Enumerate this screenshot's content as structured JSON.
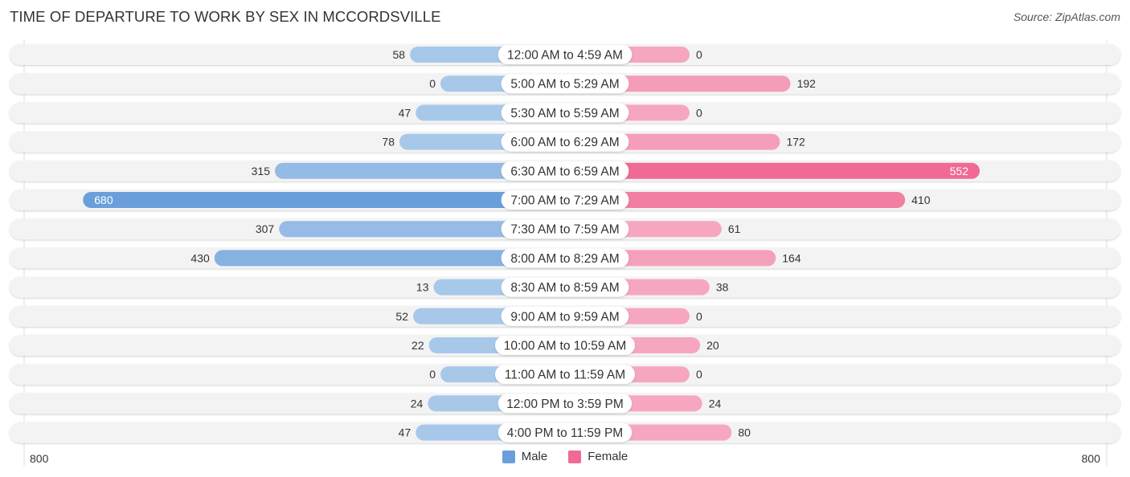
{
  "header": {
    "title": "TIME OF DEPARTURE TO WORK BY SEX IN MCCORDSVILLE",
    "source": "Source: ZipAtlas.com"
  },
  "legend": {
    "male_label": "Male",
    "female_label": "Female"
  },
  "axis": {
    "left_label": "800",
    "right_label": "800"
  },
  "colors": {
    "male": "#6a9fdc",
    "male_light": "#a8c8ea",
    "female": "#f06a94",
    "female_light": "#f6a7bf",
    "row_bg": "#f3f3f3",
    "label_bg": "#ffffff"
  },
  "chart_data": {
    "type": "bar",
    "orientation": "horizontal-diverging",
    "title": "TIME OF DEPARTURE TO WORK BY SEX IN MCCORDSVILLE",
    "xlabel": "",
    "ylabel": "",
    "xlim": [
      -800,
      800
    ],
    "legend_position": "bottom",
    "categories": [
      "12:00 AM to 4:59 AM",
      "5:00 AM to 5:29 AM",
      "5:30 AM to 5:59 AM",
      "6:00 AM to 6:29 AM",
      "6:30 AM to 6:59 AM",
      "7:00 AM to 7:29 AM",
      "7:30 AM to 7:59 AM",
      "8:00 AM to 8:29 AM",
      "8:30 AM to 8:59 AM",
      "9:00 AM to 9:59 AM",
      "10:00 AM to 10:59 AM",
      "11:00 AM to 11:59 AM",
      "12:00 PM to 3:59 PM",
      "4:00 PM to 11:59 PM"
    ],
    "series": [
      {
        "name": "Male",
        "values": [
          58,
          0,
          47,
          78,
          315,
          680,
          307,
          430,
          13,
          52,
          22,
          0,
          24,
          47
        ]
      },
      {
        "name": "Female",
        "values": [
          0,
          192,
          0,
          172,
          552,
          410,
          61,
          164,
          38,
          0,
          20,
          0,
          24,
          80
        ]
      }
    ]
  }
}
